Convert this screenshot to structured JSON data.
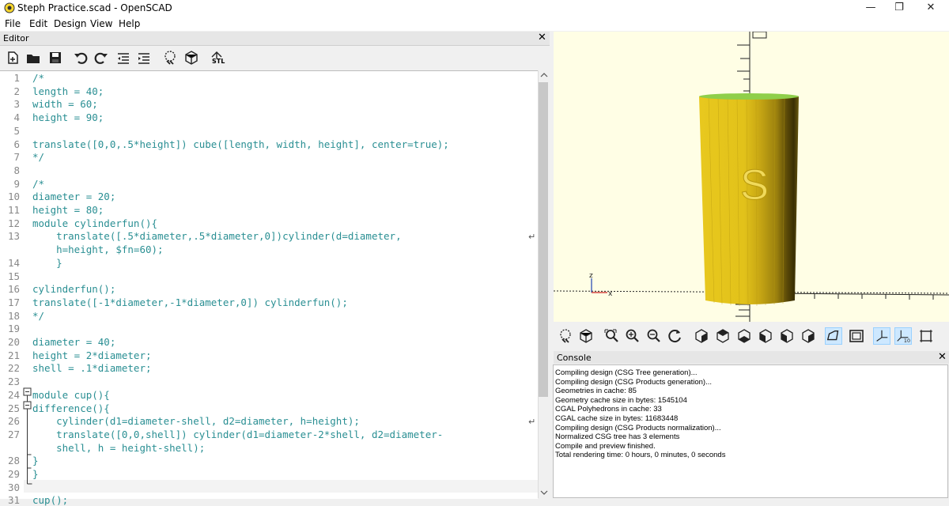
{
  "window": {
    "title": "Steph Practice.scad - OpenSCAD",
    "minimize": "—",
    "maximize": "❐",
    "close": "✕"
  },
  "menu": [
    "File",
    "Edit",
    "Design",
    "View",
    "Help"
  ],
  "editor": {
    "title": "Editor",
    "close": "✕",
    "toolbar": [
      "new-icon",
      "open-icon",
      "save-icon",
      "undo-icon",
      "redo-icon",
      "unindent-icon",
      "indent-icon",
      "preview-icon",
      "render-icon",
      "export-stl-icon"
    ],
    "stl_label": "STL",
    "lines": [
      {
        "n": "1",
        "text": "/*"
      },
      {
        "n": "2",
        "text": "length = 40;"
      },
      {
        "n": "3",
        "text": "width = 60;"
      },
      {
        "n": "4",
        "text": "height = 90;"
      },
      {
        "n": "5",
        "text": ""
      },
      {
        "n": "6",
        "text": "translate([0,0,.5*height]) cube([length, width, height], center=true);"
      },
      {
        "n": "7",
        "text": "*/"
      },
      {
        "n": "8",
        "text": ""
      },
      {
        "n": "9",
        "text": "/*"
      },
      {
        "n": "10",
        "text": "diameter = 20;"
      },
      {
        "n": "11",
        "text": "height = 80;"
      },
      {
        "n": "12",
        "text": "module cylinderfun(){"
      },
      {
        "n": "13",
        "text": "    translate([.5*diameter,.5*diameter,0])cylinder(d=diameter,"
      },
      {
        "n": "",
        "text": "    h=height, $fn=60);"
      },
      {
        "n": "14",
        "text": "    }"
      },
      {
        "n": "15",
        "text": ""
      },
      {
        "n": "16",
        "text": "cylinderfun();"
      },
      {
        "n": "17",
        "text": "translate([-1*diameter,-1*diameter,0]) cylinderfun();"
      },
      {
        "n": "18",
        "text": "*/"
      },
      {
        "n": "19",
        "text": ""
      },
      {
        "n": "20",
        "text": "diameter = 40;"
      },
      {
        "n": "21",
        "text": "height = 2*diameter;"
      },
      {
        "n": "22",
        "text": "shell = .1*diameter;"
      },
      {
        "n": "23",
        "text": ""
      },
      {
        "n": "24",
        "text": "module cup(){"
      },
      {
        "n": "25",
        "text": "difference(){"
      },
      {
        "n": "26",
        "text": "    cylinder(d1=diameter-shell, d2=diameter, h=height);"
      },
      {
        "n": "27",
        "text": "    translate([0,0,shell]) cylinder(d1=diameter-2*shell, d2=diameter-"
      },
      {
        "n": "",
        "text": "    shell, h = height-shell);"
      },
      {
        "n": "28",
        "text": "}"
      },
      {
        "n": "29",
        "text": "}"
      },
      {
        "n": "30",
        "text": ""
      },
      {
        "n": "31",
        "text": "cup();"
      }
    ]
  },
  "viewport": {
    "axis_z": "z",
    "axis_x": "x",
    "engraved_letter": "S",
    "colors": {
      "background": "#fffee5",
      "body": "#e8c81e",
      "top": "#8fcf4a"
    }
  },
  "view_toolbar": [
    "preview-icon",
    "render-icon",
    "zoom-all-icon",
    "zoom-in-icon",
    "zoom-out-icon",
    "reset-view-icon",
    "view-right-icon",
    "view-top-icon",
    "view-bottom-icon",
    "view-left-icon",
    "view-front-icon",
    "view-back-icon",
    "perspective-icon",
    "orthogonal-icon",
    "show-axes-icon",
    "show-scale-icon",
    "show-edges-icon"
  ],
  "console": {
    "title": "Console",
    "close": "✕",
    "lines": [
      "Compiling design (CSG Tree generation)...",
      "Compiling design (CSG Products generation)...",
      "Geometries in cache: 85",
      "Geometry cache size in bytes: 1545104",
      "CGAL Polyhedrons in cache: 33",
      "CGAL cache size in bytes: 11683448",
      "Compiling design (CSG Products normalization)...",
      "Normalized CSG tree has 3 elements",
      "Compile and preview finished.",
      "Total rendering time: 0 hours, 0 minutes, 0 seconds"
    ]
  }
}
